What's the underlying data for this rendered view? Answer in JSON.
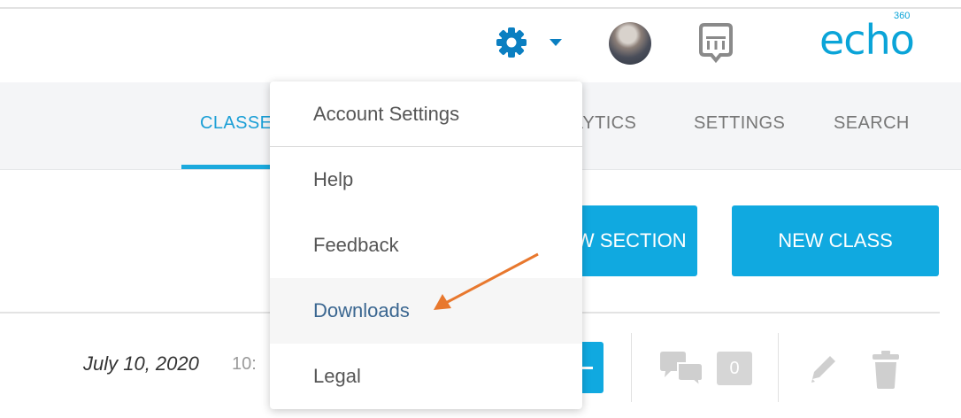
{
  "header": {
    "brand": "echo",
    "brand_superscript": "360",
    "icons": {
      "settings": "gear-icon",
      "menu_toggle": "caret-down-icon",
      "user": "avatar",
      "chat": "chat-logo-icon"
    }
  },
  "nav": {
    "tabs": [
      {
        "label": "CLASSES",
        "active": true
      },
      {
        "label": "ANALYTICS",
        "active": false
      },
      {
        "label": "SETTINGS",
        "active": false
      },
      {
        "label": "SEARCH",
        "active": false
      }
    ]
  },
  "actions": {
    "new_section": "NEW SECTION",
    "new_class": "NEW CLASS"
  },
  "row": {
    "date": "July 10, 2020",
    "time": "10:",
    "comment_count": "0",
    "icons": [
      "comments-icon",
      "pencil-icon",
      "trash-icon"
    ]
  },
  "dropdown": {
    "items": [
      "Account Settings",
      "Help",
      "Feedback",
      "Downloads",
      "Legal"
    ],
    "highlighted": "Downloads"
  },
  "colors": {
    "accent": "#10a9e0",
    "annotation_arrow": "#e8782e",
    "icon_gray": "#cfcfcf",
    "nav_band": "#f4f5f7"
  }
}
